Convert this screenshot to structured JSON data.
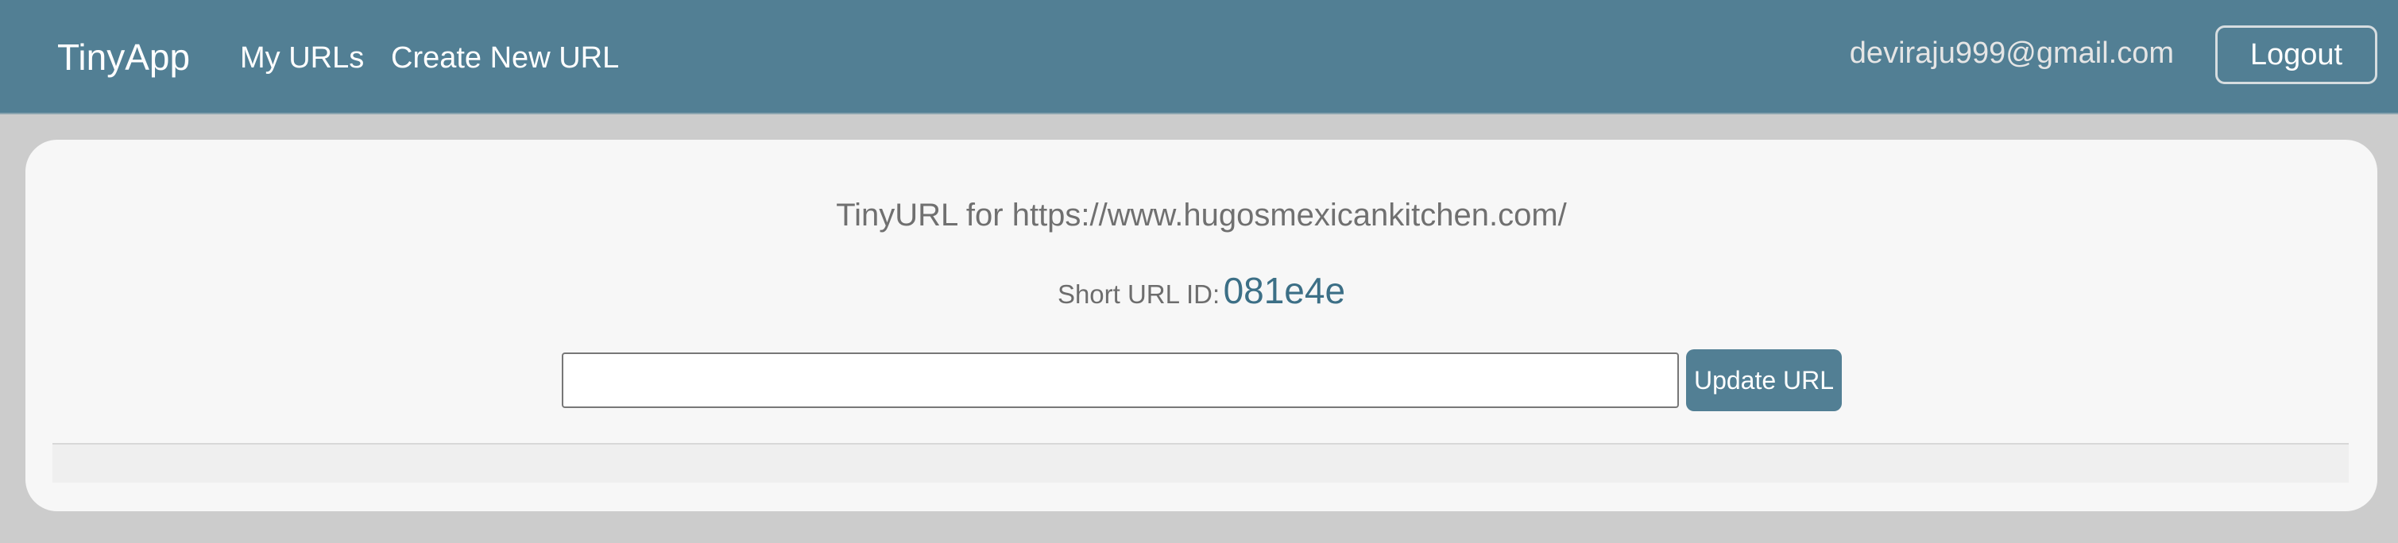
{
  "navbar": {
    "brand": "TinyApp",
    "links": [
      {
        "label": "My URLs"
      },
      {
        "label": "Create New URL"
      }
    ],
    "user_email": "deviraju999@gmail.com",
    "logout_label": "Logout"
  },
  "card": {
    "title": "TinyURL for https://www.hugosmexicankitchen.com/",
    "short_id_label": "Short URL ID:",
    "short_id_value": "081e4e",
    "input_value": "",
    "input_placeholder": "",
    "update_button_label": "Update URL"
  },
  "colors": {
    "navbar_bg": "#527f94",
    "page_bg": "#cccccc",
    "card_bg": "#f7f7f7",
    "accent_text": "#3c6f86"
  }
}
